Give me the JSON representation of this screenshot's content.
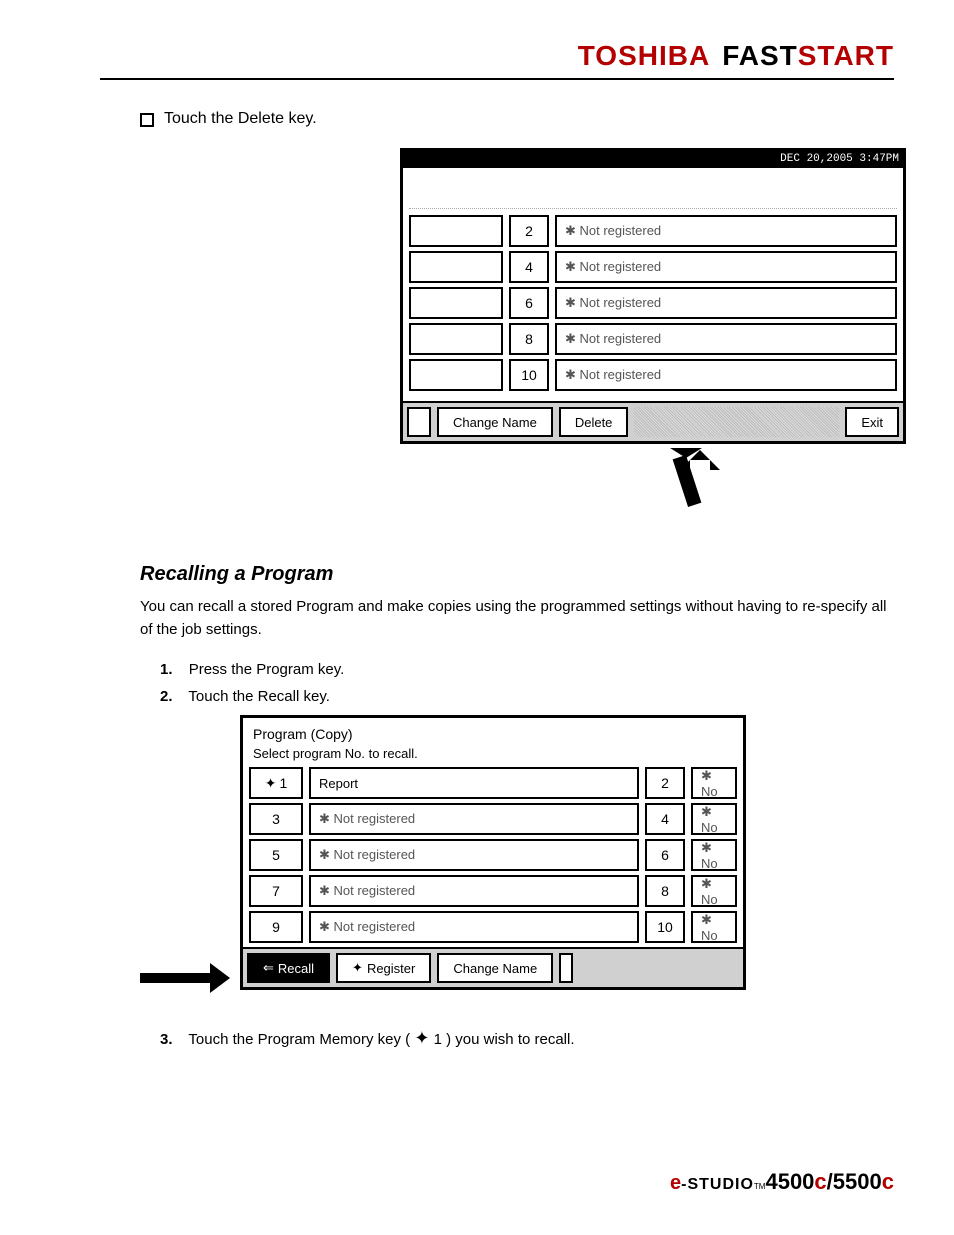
{
  "header": {
    "toshiba": "TOSHIBA",
    "fast": "FAST",
    "start": "START"
  },
  "step_delete": "Touch the Delete key.",
  "screen1": {
    "datetime": "DEC  20,2005  3:47PM",
    "rows": [
      {
        "num": "2",
        "label": "✱ Not registered"
      },
      {
        "num": "4",
        "label": "✱ Not registered"
      },
      {
        "num": "6",
        "label": "✱ Not registered"
      },
      {
        "num": "8",
        "label": "✱ Not registered"
      },
      {
        "num": "10",
        "label": "✱ Not registered"
      }
    ],
    "btn_change": "Change Name",
    "btn_delete": "Delete",
    "btn_exit": "Exit"
  },
  "section_heading": "Recalling a Program",
  "section_body": "You can recall a stored Program and make copies using the programmed settings without having to re-specify all of the job settings.",
  "step1_num": "1.",
  "step1_text": "Press the Program key.",
  "step2_num": "2.",
  "step2_text": "Touch the Recall key.",
  "screen2": {
    "title": "Program (Copy)",
    "subtitle": "Select program No. to recall.",
    "rows_left": [
      {
        "num": "1",
        "label": "Report",
        "icon": true
      },
      {
        "num": "3",
        "label": "✱ Not registered"
      },
      {
        "num": "5",
        "label": "✱ Not registered"
      },
      {
        "num": "7",
        "label": "✱ Not registered"
      },
      {
        "num": "9",
        "label": "✱ Not registered"
      }
    ],
    "rows_right": [
      {
        "num": "2",
        "label": "✱ No"
      },
      {
        "num": "4",
        "label": "✱ No"
      },
      {
        "num": "6",
        "label": "✱ No"
      },
      {
        "num": "8",
        "label": "✱ No"
      },
      {
        "num": "10",
        "label": "✱ No"
      }
    ],
    "btn_recall": "Recall",
    "btn_register": "Register",
    "btn_change": "Change Name"
  },
  "step3_num": "3.",
  "step3_text_pre": "Touch the Program Memory key (",
  "step3_text_mid": "1",
  "step3_text_post": ") you wish to recall.",
  "footer": {
    "e": "e",
    "studio": "-STUDIO",
    "tm": "TM",
    "model1": "4500",
    "c": "c",
    "slash": "/",
    "model2": "5500"
  }
}
